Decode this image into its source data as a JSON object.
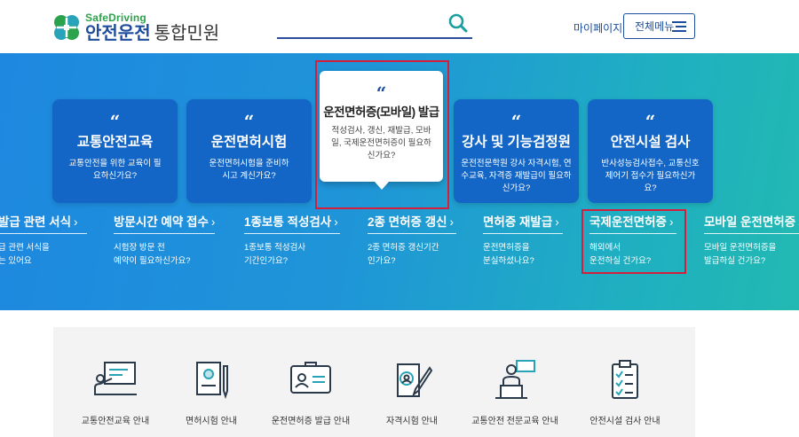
{
  "header": {
    "logo_sub": "SafeDriving",
    "logo_main": "안전운전",
    "logo_tail": "통합민원",
    "search_placeholder": "",
    "mypage": "마이페이지",
    "allmenu": "전체메뉴"
  },
  "cards": [
    {
      "quote": "“",
      "title": "교통안전교육",
      "desc": "교통안전을 위한 교육이 필요하신가요?"
    },
    {
      "quote": "“",
      "title": "운전면허시험",
      "desc": "운전면허시험을 준비하시고 계신가요?"
    },
    {
      "quote": "“",
      "title": "운전면허증(모바일) 발급",
      "desc": "적성검사, 갱신, 재발급, 모바일, 국제운전면허증이 필요하신가요?"
    },
    {
      "quote": "“",
      "title": "강사 및 기능검정원",
      "desc": "운전전문학원 강사 자격시험, 연수교육, 자격증 재발급이 필요하신가요?"
    },
    {
      "quote": "“",
      "title": "안전시설 검사",
      "desc": "반사성능검사접수, 교통신호제어기 접수가 필요하신가요?"
    }
  ],
  "links": [
    {
      "title": "발급 관련 서식",
      "chev": "›",
      "desc1": "급 관련 서식을",
      "desc2": "는 있어요"
    },
    {
      "title": "방문시간 예약 접수",
      "chev": "›",
      "desc1": "시험장 방문 전",
      "desc2": "예약이 필요하신가요?"
    },
    {
      "title": "1종보통 적성검사",
      "chev": "›",
      "desc1": "1종보통 적성검사",
      "desc2": "기간인가요?"
    },
    {
      "title": "2종 면허증 갱신",
      "chev": "›",
      "desc1": "2종 면허증 갱신기간",
      "desc2": "인가요?"
    },
    {
      "title": "면허증 재발급",
      "chev": "›",
      "desc1": "운전면허증을",
      "desc2": "분실하셨나요?"
    },
    {
      "title": "국제운전면허증",
      "chev": "›",
      "desc1": "해외에서",
      "desc2": "운전하실 건가요?"
    },
    {
      "title": "모바일 운전면허증",
      "chev": "›",
      "desc1": "모바일 운전면허증을",
      "desc2": "발급하실 건가요?"
    }
  ],
  "services": [
    {
      "label": "교통안전교육 안내",
      "icon": "presentation-icon"
    },
    {
      "label": "면허시험 안내",
      "icon": "document-pen-icon"
    },
    {
      "label": "운전면허증 발급 안내",
      "icon": "id-card-icon"
    },
    {
      "label": "자격시험 안내",
      "icon": "certificate-pen-icon"
    },
    {
      "label": "교통안전 전문교육 안내",
      "icon": "lecturer-icon"
    },
    {
      "label": "안전시설 검사 안내",
      "icon": "checklist-icon"
    }
  ],
  "colors": {
    "brand_blue": "#1d4d9c",
    "brand_green": "#2ba24c",
    "card_blue": "#1466c6",
    "highlight_red": "#d31f3c"
  }
}
